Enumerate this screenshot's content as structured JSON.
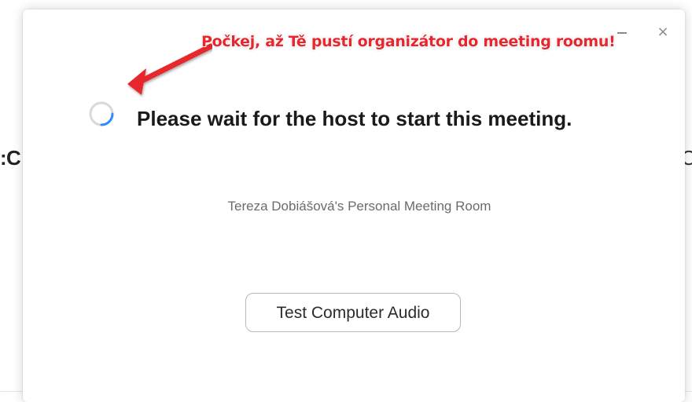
{
  "background": {
    "left_char": ":",
    "left_char2": "C",
    "right_char": "C"
  },
  "window": {
    "minimize_icon": "minimize-icon",
    "close_icon": "close-icon",
    "close_glyph": "×"
  },
  "annotation": {
    "text": "Počkej, až Tě pustí organizátor do meeting roomu!",
    "color": "#e8262d"
  },
  "main": {
    "spinner_icon": "loading-spinner-icon",
    "title": "Please wait for the host to start this meeting.",
    "room_name": "Tereza Dobiášová's Personal Meeting Room"
  },
  "actions": {
    "test_audio_label": "Test Computer Audio"
  },
  "colors": {
    "spinner_track": "#d9d9d9",
    "spinner_accent": "#2d8cff",
    "text_primary": "#1a1a1a",
    "text_secondary": "#6b6b6b"
  }
}
